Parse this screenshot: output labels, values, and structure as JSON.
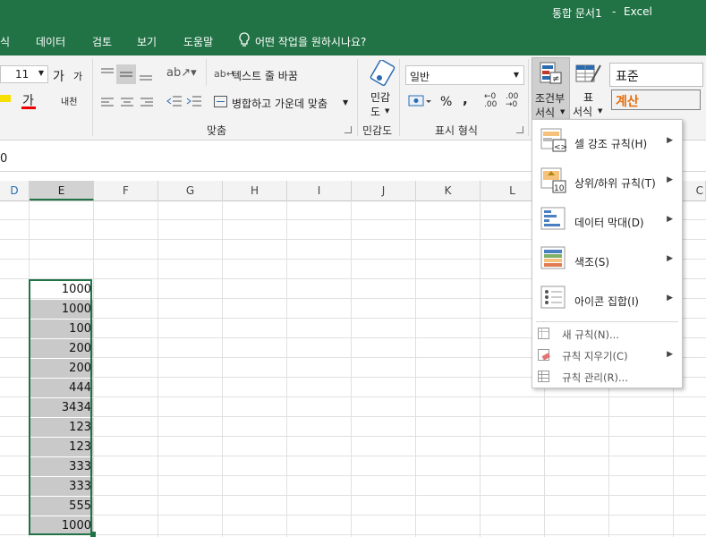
{
  "title": {
    "doc": "통합 문서1",
    "sep": "-",
    "app": "Excel"
  },
  "tabs": [
    "식",
    "데이터",
    "검토",
    "보기",
    "도움말"
  ],
  "tell_me": "어떤 작업을 원하시나요?",
  "ribbon": {
    "font_size": "11",
    "grow_font": "가",
    "shrink_font": "가",
    "font_color_glyph": "가",
    "phonetic_glyph": "내천",
    "wrap_text": "텍스트 줄 바꿈",
    "merge_center": "병합하고 가운데 맞춤",
    "align_group": "맞춤",
    "sensitivity": [
      "민감",
      "도"
    ],
    "sensitivity_group": "민감도",
    "number_format": "일반",
    "percent": "%",
    "comma": ",",
    "number_group": "표시 형식",
    "cond_format": [
      "조건부",
      "서식"
    ],
    "table_format": [
      "표",
      "서식"
    ],
    "style_normal": "표준",
    "style_calc": "계산"
  },
  "formula_value": "0",
  "columns": [
    "E",
    "F",
    "G",
    "H",
    "I",
    "J",
    "K",
    "L"
  ],
  "cells": [
    "1000",
    "1000",
    "100",
    "200",
    "200",
    "444",
    "3434",
    "123",
    "123",
    "333",
    "333",
    "555",
    "1000"
  ],
  "menu": {
    "items": [
      {
        "label": "셀 강조 규칙(H)",
        "icon": "highlight-cells-rules-icon"
      },
      {
        "label": "상위/하위 규칙(T)",
        "icon": "top-bottom-rules-icon"
      },
      {
        "label": "데이터 막대(D)",
        "icon": "data-bars-icon"
      },
      {
        "label": "색조(S)",
        "icon": "color-scales-icon"
      },
      {
        "label": "아이콘 집합(I)",
        "icon": "icon-sets-icon"
      }
    ],
    "sub_items": [
      {
        "label": "새 규칙(N)..."
      },
      {
        "label": "규칙 지우기(C)"
      },
      {
        "label": "규칙 관리(R)..."
      }
    ]
  },
  "colors": {
    "excel_green": "#217346",
    "selection": "#c9c9c9",
    "accent_orange": "#e46c0a"
  }
}
